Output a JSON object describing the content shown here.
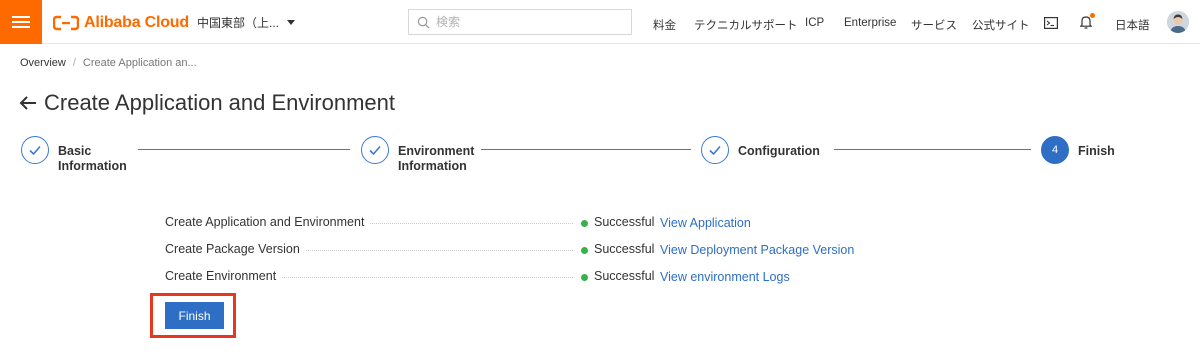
{
  "header": {
    "logo_text": "Alibaba Cloud",
    "region": "中国東部（上...",
    "search_placeholder": "検索",
    "nav_links": [
      "料金",
      "テクニカルサポート",
      "ICP",
      "Enterprise",
      "サービス",
      "公式サイト"
    ],
    "language": "日本語",
    "brand_color": "#ff6a00"
  },
  "breadcrumb": {
    "home": "Overview",
    "separator": "/",
    "current": "Create Application an..."
  },
  "page": {
    "title": "Create Application and Environment"
  },
  "steps": [
    {
      "line1": "Basic",
      "line2": "Information",
      "state": "done"
    },
    {
      "line1": "Environment",
      "line2": "Information",
      "state": "done"
    },
    {
      "line1": "Configuration",
      "line2": "",
      "state": "done"
    },
    {
      "number": "4",
      "line1": "Finish",
      "line2": "",
      "state": "active"
    }
  ],
  "results": [
    {
      "name": "Create Application and Environment",
      "status": "Successful",
      "link": "View Application"
    },
    {
      "name": "Create Package Version",
      "status": "Successful",
      "link": "View Deployment Package Version"
    },
    {
      "name": "Create Environment",
      "status": "Successful",
      "link": "View environment Logs"
    }
  ],
  "actions": {
    "finish_label": "Finish"
  },
  "colors": {
    "primary": "#2e6ec5",
    "success": "#36b24a",
    "highlight": "#e8371f"
  }
}
